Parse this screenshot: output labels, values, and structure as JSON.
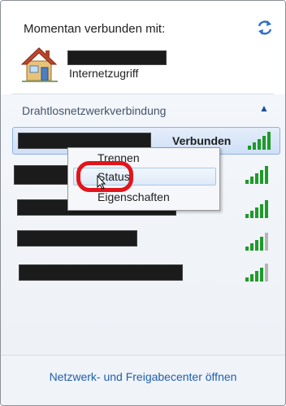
{
  "header": {
    "title": "Momentan verbunden mit:",
    "refresh_icon": "refresh-icon",
    "house_icon": "house-network-icon",
    "connection_type": "Internetzugriff"
  },
  "section": {
    "title": "Drahtlosnetzwerkverbindung",
    "collapse_icon": "chevron-up-icon",
    "collapse_glyph": "▲"
  },
  "networks": [
    {
      "status": "Verbunden",
      "signal_bars": 5
    },
    {
      "status": "",
      "signal_bars": 5
    },
    {
      "status": "",
      "signal_bars": 5
    },
    {
      "status": "",
      "signal_bars": 4
    },
    {
      "status": "",
      "signal_bars": 4
    }
  ],
  "context_menu": {
    "items": [
      "Trennen",
      "Status",
      "Eigenschaften"
    ],
    "highlighted": "Status"
  },
  "footer": {
    "link": "Netzwerk- und Freigabecenter öffnen"
  },
  "colors": {
    "accent": "#1f5fae",
    "highlight_ring": "#e3141b",
    "signal_green": "#1f9a2a",
    "signal_gray": "#b5b5b5"
  }
}
